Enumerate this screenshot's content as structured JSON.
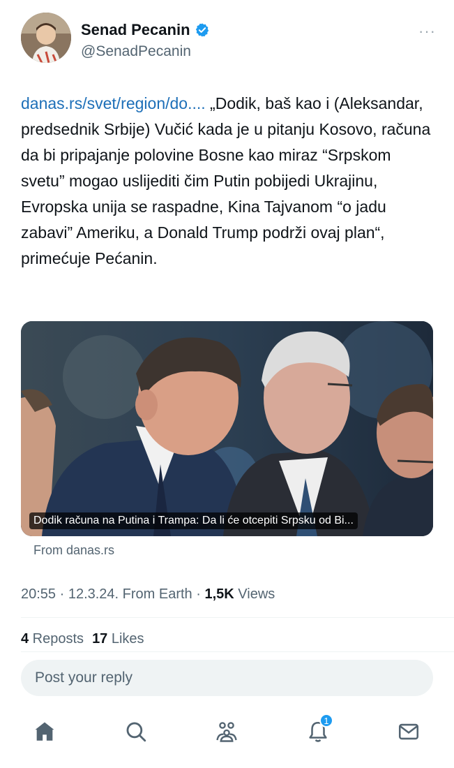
{
  "author": {
    "display_name": "Senad Pecanin",
    "handle": "@SenadPecanin",
    "verified_icon": "verified-badge-icon",
    "more_label": "···"
  },
  "tweet": {
    "link_text": "danas.rs/svet/region/do....",
    "body": " „Dodik, baš kao i (Aleksandar, predsednik Srbije) Vučić kada je u pitanju Kosovo, računa da bi pripajanje polovine Bosne kao miraz “Srpskom svetu” mogao uslijediti čim Putin pobijedi Ukrajinu, Evropska unija se raspadne, Kina Tajvanom “o jadu zabavi” Ameriku, a Donald Trump podrži ovaj plan“, primećuje Pećanin."
  },
  "card": {
    "caption": "Dodik računa na Putina i Trampa: Da li će otcepiti Srpsku od Bi...",
    "source": "From danas.rs"
  },
  "meta": {
    "time_date": "20:55 · 12.3.24. From Earth · ",
    "views_count": "1,5K",
    "views_label": " Views"
  },
  "stats": {
    "reposts_count": "4",
    "reposts_label": " Reposts",
    "likes_count": "17",
    "likes_label": " Likes"
  },
  "reply": {
    "placeholder": "Post your reply"
  },
  "nav": {
    "items": [
      {
        "icon": "home-icon"
      },
      {
        "icon": "search-icon"
      },
      {
        "icon": "communities-icon"
      },
      {
        "icon": "notifications-icon",
        "badge": "1"
      },
      {
        "icon": "messages-icon"
      }
    ]
  },
  "colors": {
    "link": "#1d6fb8",
    "accent": "#1d9bf0",
    "secondary_text": "#536471"
  }
}
